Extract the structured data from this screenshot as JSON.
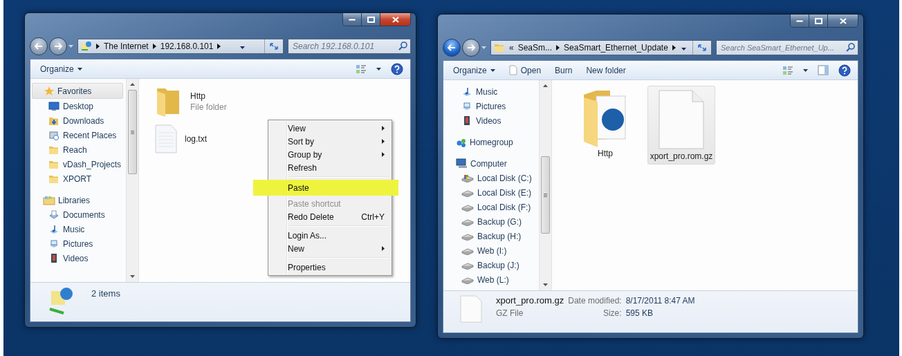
{
  "windows": [
    {
      "active": true,
      "back_enabled": false,
      "address": {
        "kind": "network",
        "breadcrumb": [
          "The Internet",
          "192.168.0.101"
        ]
      },
      "search": {
        "placeholder": "Search 192.168.0.101"
      },
      "toolbar": [
        {
          "label": "Organize",
          "kind": "menu"
        }
      ],
      "preview_pane_button": false,
      "sidebar": [
        {
          "header": {
            "label": "Favorites",
            "kind": "favorites",
            "selected": true
          },
          "items": [
            {
              "label": "Desktop",
              "kind": "desktop",
              "selected": false
            },
            {
              "label": "Downloads",
              "kind": "downloads",
              "selected": false
            },
            {
              "label": "Recent Places",
              "kind": "recent",
              "selected": false
            },
            {
              "label": "Reach",
              "kind": "folder",
              "selected": false
            },
            {
              "label": "vDash_Projects",
              "kind": "folder",
              "selected": false
            },
            {
              "label": "XPORT",
              "kind": "folder",
              "selected": false
            }
          ]
        },
        {
          "header": {
            "label": "Libraries",
            "kind": "libraries",
            "selected": false
          },
          "items": [
            {
              "label": "Documents",
              "kind": "documents",
              "selected": false
            },
            {
              "label": "Music",
              "kind": "music",
              "selected": false
            },
            {
              "label": "Pictures",
              "kind": "pictures",
              "selected": false
            },
            {
              "label": "Videos",
              "kind": "videos",
              "selected": false
            }
          ]
        }
      ],
      "file_area": {
        "kind": "tiles",
        "files": [
          {
            "name": "Http",
            "subtitle": "File folder",
            "kind": "folder",
            "selected": false
          },
          {
            "name": "log.txt",
            "kind": "text",
            "selected": false
          }
        ]
      },
      "context_menu": [
        [
          {
            "label": "View",
            "submenu": true,
            "disabled": false,
            "selected": false
          },
          {
            "label": "Sort by",
            "submenu": true,
            "disabled": false,
            "selected": false
          },
          {
            "label": "Group by",
            "submenu": true,
            "disabled": false,
            "selected": false
          },
          {
            "label": "Refresh",
            "submenu": false,
            "disabled": false,
            "selected": false
          }
        ],
        [
          {
            "label": "Paste",
            "submenu": false,
            "disabled": false,
            "selected": true
          },
          {
            "label": "Paste shortcut",
            "submenu": false,
            "disabled": true,
            "selected": false
          },
          {
            "label": "Redo Delete",
            "shortcut": "Ctrl+Y",
            "submenu": false,
            "disabled": false,
            "selected": false
          }
        ],
        [
          {
            "label": "Login As...",
            "submenu": false,
            "disabled": false,
            "selected": false
          },
          {
            "label": "New",
            "submenu": true,
            "disabled": false,
            "selected": false
          }
        ],
        [
          {
            "label": "Properties",
            "submenu": false,
            "disabled": false,
            "selected": false
          }
        ]
      ],
      "details": {
        "kind": "summary",
        "text": "2 items"
      }
    },
    {
      "active": false,
      "back_enabled": true,
      "address": {
        "kind": "folder",
        "overflow_mark": "«",
        "breadcrumb": [
          "SeaSm...",
          "SeaSmart_Ethernet_Update"
        ]
      },
      "search": {
        "placeholder": "Search SeaSmart_Ethernet_Up..."
      },
      "toolbar": [
        {
          "label": "Organize",
          "kind": "menu"
        },
        {
          "label": "Open",
          "kind": "open"
        },
        {
          "label": "Burn",
          "kind": "plain"
        },
        {
          "label": "New folder",
          "kind": "plain"
        }
      ],
      "preview_pane_button": true,
      "sidebar": [
        {
          "items": [
            {
              "label": "Music",
              "kind": "music",
              "selected": false
            },
            {
              "label": "Pictures",
              "kind": "pictures",
              "selected": false
            },
            {
              "label": "Videos",
              "kind": "videos",
              "selected": false
            }
          ]
        },
        {
          "header": {
            "label": "Homegroup",
            "kind": "homegroup",
            "selected": false
          }
        },
        {
          "header": {
            "label": "Computer",
            "kind": "computer",
            "selected": false
          },
          "items": [
            {
              "label": "Local Disk (C:)",
              "kind": "system-drive",
              "selected": false
            },
            {
              "label": "Local Disk (E:)",
              "kind": "drive",
              "selected": false
            },
            {
              "label": "Local Disk (F:)",
              "kind": "drive",
              "selected": false
            },
            {
              "label": "Backup (G:)",
              "kind": "drive",
              "selected": false
            },
            {
              "label": "Backup (H:)",
              "kind": "drive",
              "selected": false
            },
            {
              "label": "Web (I:)",
              "kind": "drive",
              "selected": false
            },
            {
              "label": "Backup (J:)",
              "kind": "drive",
              "selected": false
            },
            {
              "label": "Web (L:)",
              "kind": "drive",
              "selected": false
            }
          ]
        }
      ],
      "file_area": {
        "kind": "large_icons",
        "files": [
          {
            "name": "Http",
            "kind": "web-folder",
            "selected": false
          },
          {
            "name": "xport_pro.rom.gz",
            "kind": "file",
            "selected": true
          }
        ]
      },
      "details": {
        "kind": "file",
        "name": "xport_pro.rom.gz",
        "type": "GZ File",
        "fields": [
          {
            "label": "Date modified:",
            "value": "8/17/2011 8:47 AM"
          },
          {
            "label": "Size:",
            "value": "595 KB"
          }
        ]
      }
    }
  ]
}
